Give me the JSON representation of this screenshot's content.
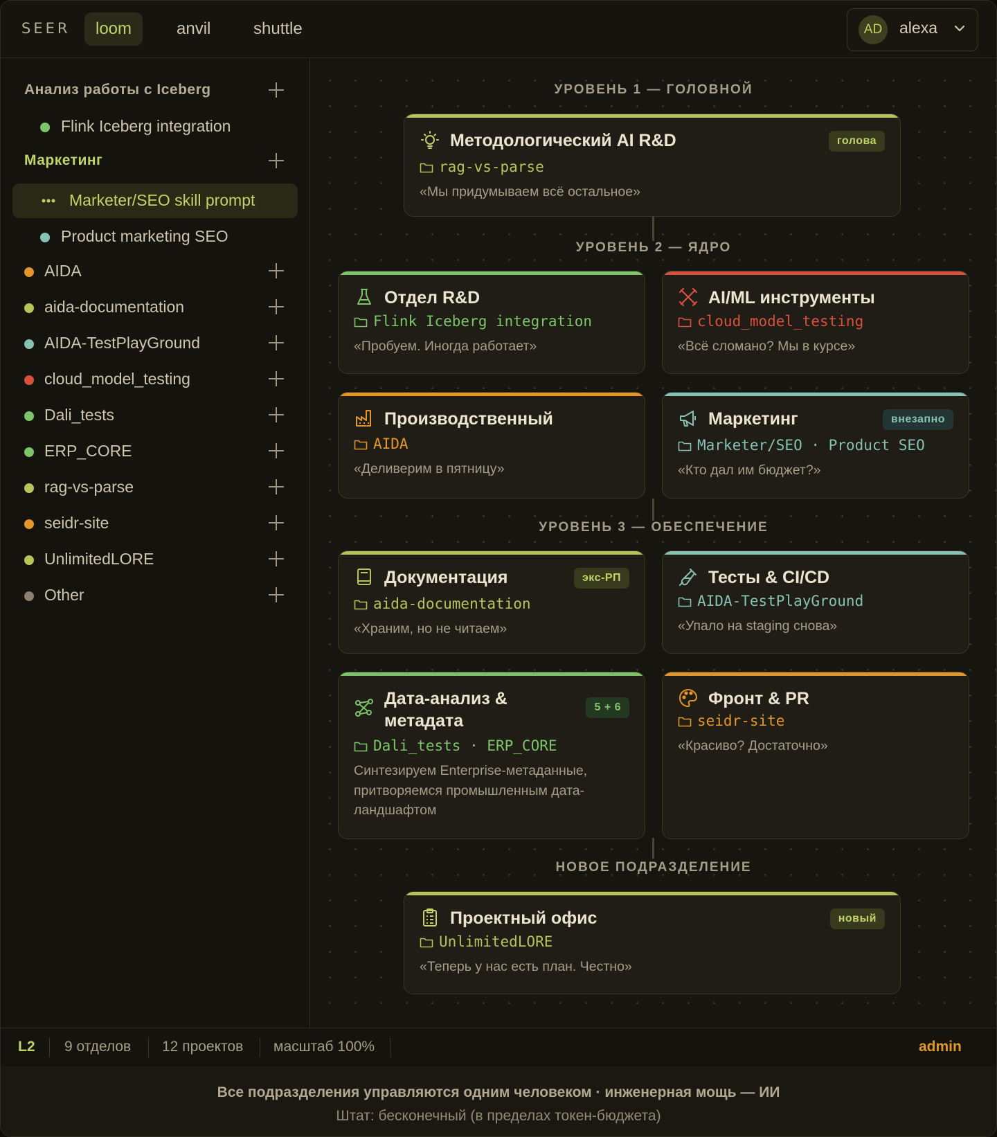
{
  "topbar": {
    "brand": "SEER",
    "tabs": [
      {
        "label": "loom",
        "active": true
      },
      {
        "label": "anvil",
        "active": false
      },
      {
        "label": "shuttle",
        "active": false
      }
    ],
    "user": {
      "initials": "AD",
      "name": "alexa"
    }
  },
  "sidebar": {
    "group1": {
      "title": "Анализ работы с Iceberg",
      "item": "Flink Iceberg integration"
    },
    "group2": {
      "title": "Маркетинг",
      "selected": "Marketer/SEO skill prompt",
      "item": "Product marketing SEO"
    },
    "projects": [
      {
        "label": "AIDA",
        "color": "#e3962a"
      },
      {
        "label": "aida-documentation",
        "color": "#b8c35a"
      },
      {
        "label": "AIDA-TestPlayGround",
        "color": "#86c2b3"
      },
      {
        "label": "cloud_model_testing",
        "color": "#d9503f"
      },
      {
        "label": "Dali_tests",
        "color": "#7dc46a"
      },
      {
        "label": "ERP_CORE",
        "color": "#7dc46a"
      },
      {
        "label": "rag-vs-parse",
        "color": "#b8c35a"
      },
      {
        "label": "seidr-site",
        "color": "#e3962a"
      },
      {
        "label": "UnlimitedLORE",
        "color": "#b8c35a"
      },
      {
        "label": "Other",
        "color": "#8b826e"
      }
    ]
  },
  "levels": {
    "l1": "УРОВЕНЬ 1 — ГОЛОВНОЙ",
    "l2": "УРОВЕНЬ 2 — ЯДРО",
    "l3": "УРОВЕНЬ 3 — ОБЕСПЕЧЕНИЕ",
    "l4": "НОВОЕ ПОДРАЗДЕЛЕНИЕ"
  },
  "cards": {
    "head": {
      "title": "Методологический AI R&D",
      "badge": "голова",
      "project": "rag-vs-parse",
      "quote": "«Мы придумываем всё остальное»"
    },
    "rnd": {
      "title": "Отдел R&D",
      "project": "Flink Iceberg integration",
      "quote": "«Пробуем. Иногда работает»"
    },
    "aiml": {
      "title": "AI/ML инструменты",
      "project": "cloud_model_testing",
      "quote": "«Всё сломано? Мы в курсе»"
    },
    "prod": {
      "title": "Производственный",
      "project": "AIDA",
      "quote": "«Деливерим в пятницу»"
    },
    "mkt": {
      "title": "Маркетинг",
      "badge": "внезапно",
      "project": "Marketer/SEO · Product SEO",
      "quote": "«Кто дал им бюджет?»"
    },
    "docs": {
      "title": "Документация",
      "badge": "экс-РП",
      "project": "aida-documentation",
      "quote": "«Храним, но не читаем»"
    },
    "tests": {
      "title": "Тесты & CI/CD",
      "project": "AIDA-TestPlayGround",
      "quote": "«Упало на staging снова»"
    },
    "data": {
      "title1": "Дата-анализ &",
      "title2": "метадата",
      "badge": "5 + 6",
      "project": "Dali_tests · ERP_CORE",
      "quote1": "Синтезируем Enterprise-метаданные,",
      "quote2": "притворяемся промышленным дата-",
      "quote3": "ландшафтом"
    },
    "front": {
      "title": "Фронт & PR",
      "project": "seidr-site",
      "quote": "«Красиво? Достаточно»"
    },
    "pmo": {
      "title": "Проектный офис",
      "badge": "новый",
      "project": "UnlimitedLORE",
      "quote": "«Теперь у нас есть план. Честно»"
    }
  },
  "status": {
    "level": "L2",
    "depts": "9 отделов",
    "projects": "12 проектов",
    "zoom": "масштаб 100%",
    "role": "admin"
  },
  "footer": {
    "line1": "Все подразделения управляются одним человеком · инженерная мощь — ИИ",
    "line2": "Штат: бесконечный (в пределах токен-бюджета)"
  },
  "colors": {
    "accent": "#c3d36a",
    "green": "#7dc46a",
    "orange": "#e3962a",
    "red": "#d9503f",
    "teal": "#86c2b3",
    "olive": "#b8c35a"
  }
}
